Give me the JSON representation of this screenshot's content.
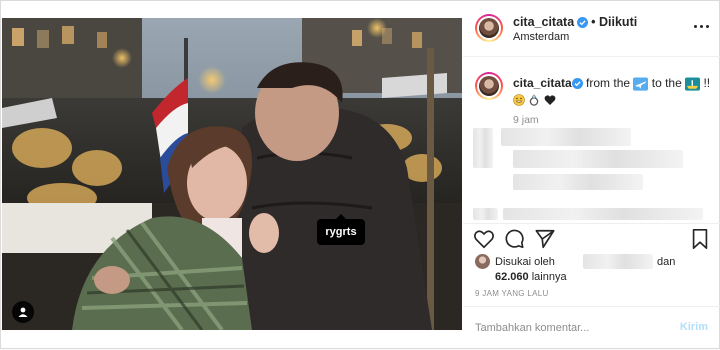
{
  "post": {
    "author": {
      "username": "cita_citata",
      "verified": true,
      "follow_state": "• Diikuti",
      "location": "Amsterdam"
    },
    "caption": {
      "username": "cita_citata",
      "text_1": "from the",
      "text_2": "to the",
      "text_3": "!!",
      "emoji_names": [
        "airplane-emoji",
        "boat-emoji",
        "grin-emoji",
        "ring-emoji",
        "black-heart-emoji"
      ],
      "time": "9 jam"
    },
    "photo": {
      "tag_label": "rygrts"
    },
    "likes": {
      "prefix": "Disukai oleh",
      "and": "dan",
      "count": "62.060",
      "suffix": "lainnya"
    },
    "time_ago": "9 JAM YANG LALU",
    "comment_box": {
      "placeholder": "Tambahkan komentar...",
      "send_label": "Kirim"
    },
    "colors": {
      "verified_blue": "#3897f0",
      "muted_text": "#8e8e8e",
      "send_disabled": "#b2dffc"
    }
  }
}
